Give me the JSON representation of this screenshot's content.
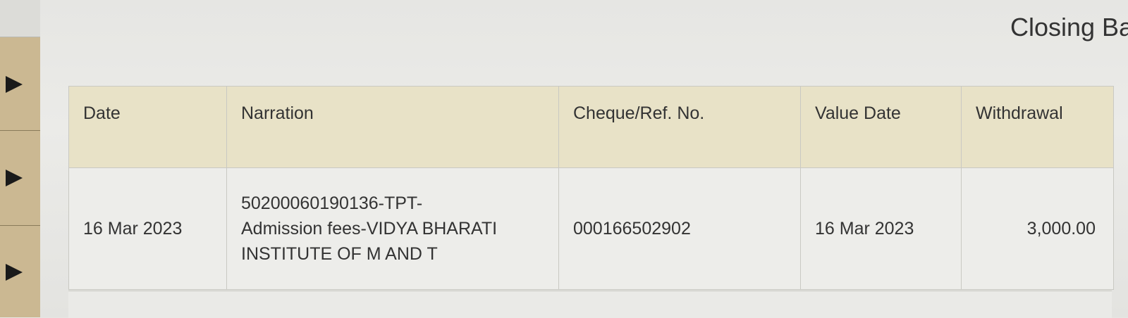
{
  "header": {
    "closing_label": "Closing Ba"
  },
  "table": {
    "columns": [
      "Date",
      "Narration",
      "Cheque/Ref. No.",
      "Value Date",
      "Withdrawal"
    ],
    "rows": [
      {
        "date": "16 Mar 2023",
        "narration_lines": [
          "50200060190136-TPT-",
          "Admission fees-VIDYA BHARATI",
          "INSTITUTE OF M AND T"
        ],
        "ref": "000166502902",
        "value_date": "16 Mar 2023",
        "withdrawal": "3,000.00"
      }
    ]
  },
  "colors": {
    "header_bg": "#e8e2c7",
    "sidebar": "#cbb892"
  }
}
